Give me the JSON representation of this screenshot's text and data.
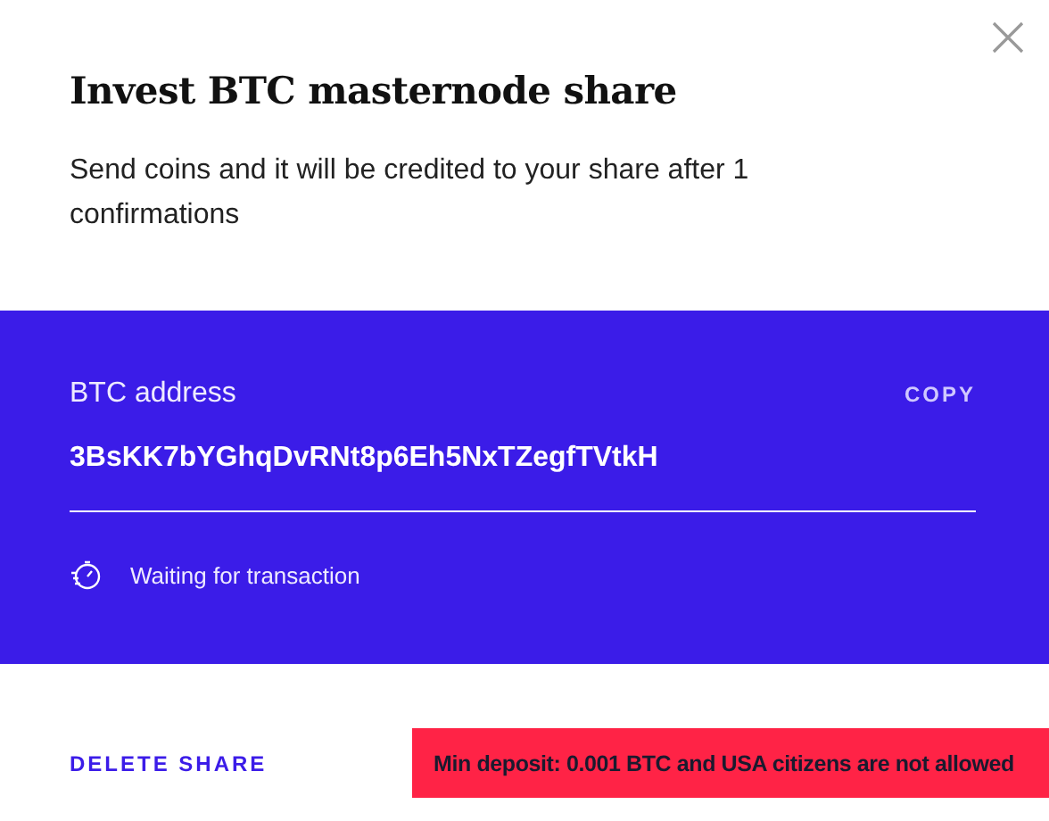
{
  "dialog": {
    "title": "Invest BTC masternode share",
    "description": "Send coins and it will be credited to your share after 1 confirmations"
  },
  "address_panel": {
    "label": "BTC address",
    "copy_button": "COPY",
    "address": "3BsKK7bYGhqDvRNt8p6Eh5NxTZegfTVtkH",
    "status": "Waiting for transaction"
  },
  "footer": {
    "delete_button": "DELETE SHARE",
    "notice": "Min deposit: 0.001 BTC and USA citizens are not allowed"
  }
}
